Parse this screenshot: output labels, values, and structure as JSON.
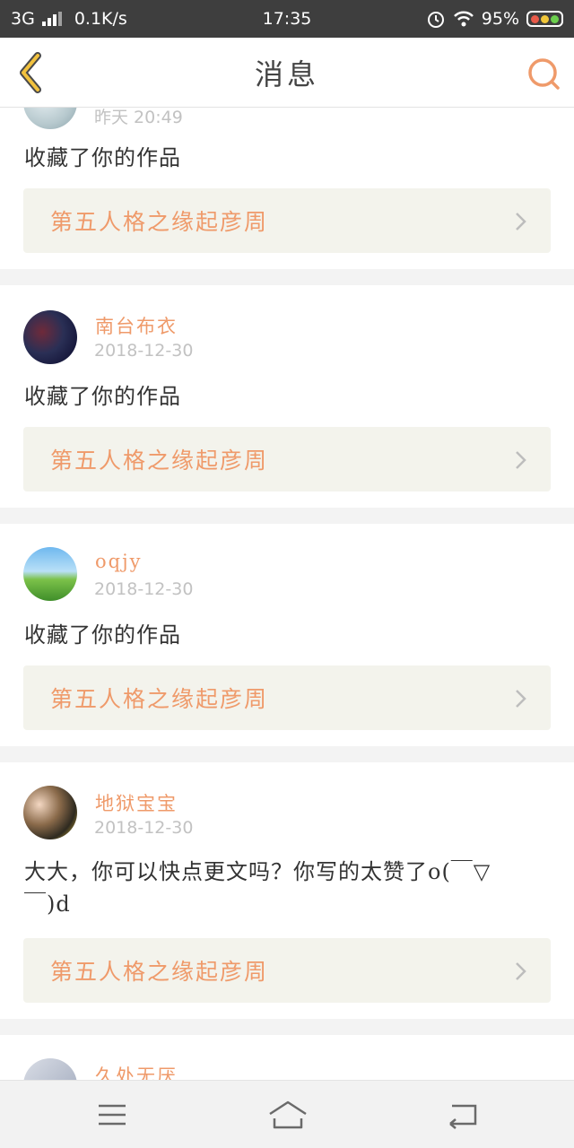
{
  "status_bar": {
    "network": "3G",
    "speed": "0.1K/s",
    "time": "17:35",
    "battery": "95%",
    "icons": [
      "signal-icon",
      "alarm-icon",
      "wifi-icon",
      "battery-icon"
    ]
  },
  "header": {
    "title": "消息",
    "back_icon": "chevron-left-icon",
    "search_icon": "search-icon"
  },
  "messages": [
    {
      "user": "",
      "date": "昨天 20:49",
      "text": "收藏了你的作品",
      "work": "第五人格之缘起彦周"
    },
    {
      "user": "南台布衣",
      "date": "2018-12-30",
      "text": "收藏了你的作品",
      "work": "第五人格之缘起彦周"
    },
    {
      "user": "oqjy",
      "date": "2018-12-30",
      "text": "收藏了你的作品",
      "work": "第五人格之缘起彦周"
    },
    {
      "user": "地狱宝宝",
      "date": "2018-12-30",
      "text": "大大，你可以快点更文吗？你写的太赞了o(￣▽￣)d",
      "work": "第五人格之缘起彦周"
    },
    {
      "user": "久处无厌",
      "date": "",
      "text": "",
      "work": ""
    }
  ],
  "nav": {
    "icons": [
      "menu-icon",
      "home-icon",
      "back-icon"
    ]
  },
  "colors": {
    "accent": "#ef9a6a",
    "status_bar": "#3e3e3e",
    "link_bg": "#f3f3ec"
  }
}
